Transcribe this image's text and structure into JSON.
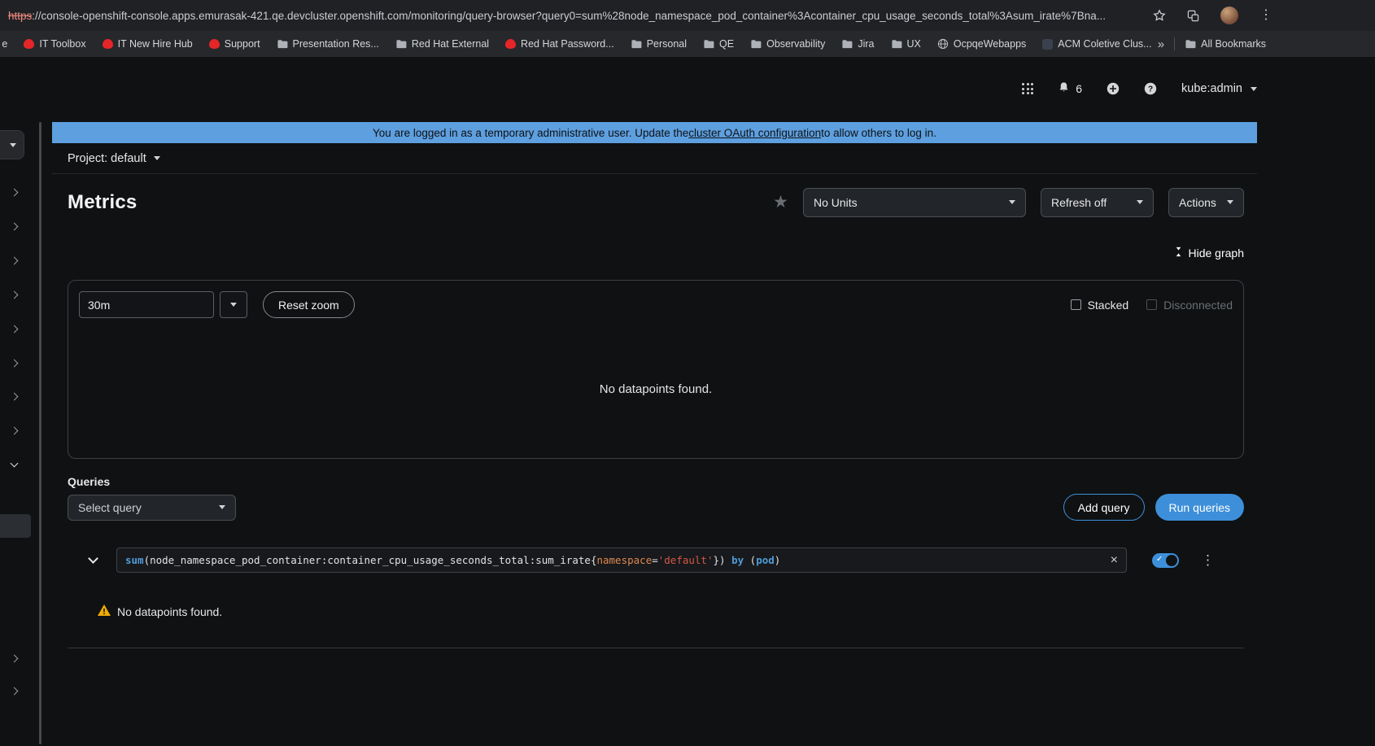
{
  "browser": {
    "url": {
      "scheme": "https",
      "rest": "://console-openshift-console.apps.emurasak-421.qe.devcluster.openshift.com/monitoring/query-browser?query0=sum%28node_namespace_pod_container%3Acontainer_cpu_usage_seconds_total%3Asum_irate%7Bna..."
    },
    "bookmarks": [
      {
        "icon": "none",
        "label": "rce"
      },
      {
        "icon": "redhat",
        "label": "IT Toolbox"
      },
      {
        "icon": "redhat",
        "label": "IT New Hire Hub"
      },
      {
        "icon": "redhat",
        "label": "Support"
      },
      {
        "icon": "folder",
        "label": "Presentation Res..."
      },
      {
        "icon": "folder",
        "label": "Red Hat External"
      },
      {
        "icon": "redhat",
        "label": "Red Hat Password..."
      },
      {
        "icon": "folder",
        "label": "Personal"
      },
      {
        "icon": "folder",
        "label": "QE"
      },
      {
        "icon": "folder",
        "label": "Observability"
      },
      {
        "icon": "folder",
        "label": "Jira"
      },
      {
        "icon": "folder",
        "label": "UX"
      },
      {
        "icon": "globe",
        "label": "OcpqeWebapps"
      },
      {
        "icon": "acm",
        "label": "ACM Coletive Clus..."
      }
    ],
    "overflow_chevron": "»",
    "all_bookmarks": "All Bookmarks"
  },
  "masthead": {
    "notification_count": "6",
    "username": "kube:admin"
  },
  "banner": {
    "before": "You are logged in as a temporary administrative user. Update the ",
    "link": "cluster OAuth configuration",
    "after": " to allow others to log in."
  },
  "project_bar": {
    "label": "Project: default"
  },
  "page": {
    "title": "Metrics",
    "units_dropdown": "No Units",
    "refresh_dropdown": "Refresh off",
    "actions_dropdown": "Actions",
    "hide_graph": "Hide graph"
  },
  "graph": {
    "timespan": "30m",
    "reset_zoom": "Reset zoom",
    "stacked_label": "Stacked",
    "disconnected_label": "Disconnected",
    "empty_message": "No datapoints found."
  },
  "queries": {
    "heading": "Queries",
    "select_placeholder": "Select query",
    "add_button": "Add query",
    "run_button": "Run queries",
    "warning": "No datapoints found.",
    "promql": {
      "kw_sum": "sum",
      "body1": "(node_namespace_pod_container:container_cpu_usage_seconds_total:sum_irate{",
      "label": "namespace",
      "op": "=",
      "value": "'default'",
      "body2": "}) ",
      "kw_by": "by",
      "body3": " (",
      "ident": "pod",
      "body4": ")"
    }
  },
  "icons": {
    "favorite_star": "★",
    "browser_menu": "⋮",
    "query_kebab": "⋮",
    "query_clear": "×",
    "switch_check": "✓"
  },
  "colors": {
    "banner_background": "#5e9fdf",
    "primary_button": "#3e8fd9",
    "warning_icon": "#f0ab00",
    "promql_keyword": "#4f9cdb",
    "promql_label": "#e0894f",
    "promql_string": "#d65745",
    "https_strikethrough": "#f28b82"
  }
}
